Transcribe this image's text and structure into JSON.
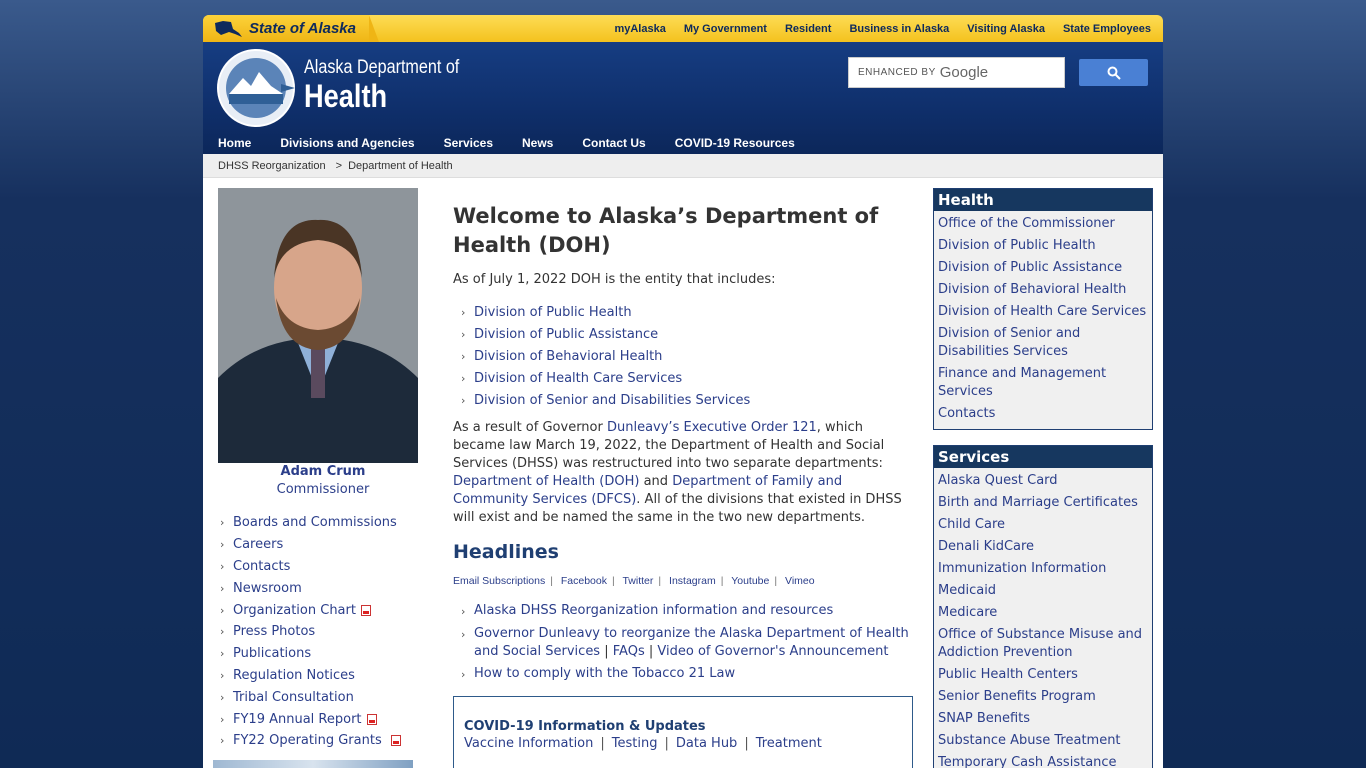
{
  "topbar": {
    "state_name": "State of Alaska",
    "links": [
      "myAlaska",
      "My Government",
      "Resident",
      "Business in Alaska",
      "Visiting Alaska",
      "State Employees"
    ]
  },
  "header": {
    "dept_line1": "Alaska Department of",
    "dept_line2": "Health",
    "search_placeholder": "ENHANCED BY",
    "search_brand": "Google"
  },
  "nav": [
    "Home",
    "Divisions and Agencies",
    "Services",
    "News",
    "Contact Us",
    "COVID-19 Resources"
  ],
  "breadcrumb": [
    "DHSS Reorganization",
    ">",
    "Department of Health"
  ],
  "left": {
    "name": "Adam Crum",
    "title": "Commissioner",
    "links": [
      "Boards and Commissions",
      "Careers",
      "Contacts",
      "Newsroom",
      "Organization Chart",
      "Press Photos",
      "Publications",
      "Regulation Notices",
      "Tribal Consultation",
      "FY19 Annual Report",
      "FY22 Operating Grants"
    ]
  },
  "main": {
    "title": "Welcome to Alaska’s Department of Health (DOH)",
    "intro": "As of July 1, 2022 DOH is the entity that includes:",
    "divisions": [
      "Division of Public Health",
      "Division of Public Assistance",
      "Division of Behavioral Health",
      "Division of Health Care Services",
      "Division of Senior and Disabilities Services"
    ],
    "para": {
      "t1": "As a result of Governor ",
      "l1": "Dunleavy’s Executive Order 121",
      "t2": ", which became law March 19, 2022, the Department of Health and Social Services (DHSS) was restructured into two separate departments: ",
      "l2": "Department of Health (DOH)",
      "t3": " and ",
      "l3": "Department of Family and Community Services (DFCS)",
      "t4": ". All of the divisions that existed in DHSS will exist and be named the same in the two new departments."
    },
    "headlines_title": "Headlines",
    "social": [
      "Email Subscriptions",
      "Facebook",
      "Twitter",
      "Instagram",
      "Youtube",
      "Vimeo"
    ],
    "news": {
      "n1": "Alaska DHSS Reorganization information and resources",
      "n2a": "Governor Dunleavy to reorganize the Alaska Department of Health and Social Services",
      "n2b": "FAQs",
      "n2c": "Video of Governor's Announcement",
      "n3": "How to comply with the Tobacco 21 Law"
    },
    "covid": {
      "title": "COVID-19 Information & Updates",
      "links": [
        "Vaccine Information",
        "Testing",
        "Data Hub",
        "Treatment"
      ]
    }
  },
  "right": {
    "health_title": "Health",
    "health_links": [
      "Office of the Commissioner",
      "Division of Public Health",
      "Division of Public Assistance",
      "Division of Behavioral Health",
      "Division of Health Care Services",
      "Division of Senior and Disabilities Services",
      "Finance and Management Services",
      "Contacts"
    ],
    "services_title": "Services",
    "services_links": [
      "Alaska Quest Card",
      "Birth and Marriage Certificates",
      "Child Care",
      "Denali KidCare",
      "Immunization Information",
      "Medicaid",
      "Medicare",
      "Office of Substance Misuse and Addiction Prevention",
      "Public Health Centers",
      "Senior Benefits Program",
      "SNAP Benefits",
      "Substance Abuse Treatment",
      "Temporary Cash Assistance"
    ]
  }
}
